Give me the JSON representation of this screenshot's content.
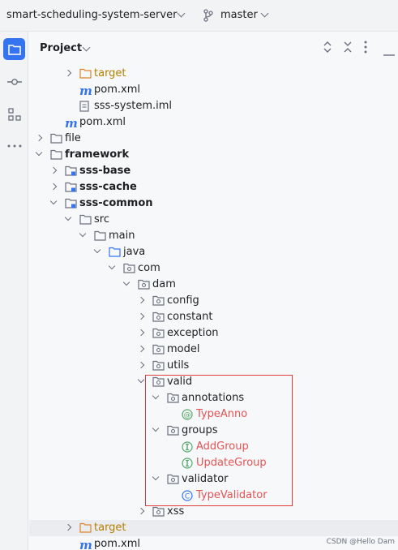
{
  "titlebar": {
    "project": "smart-scheduling-system-server",
    "branch": "master"
  },
  "rail": {
    "buttons": [
      "project-icon",
      "commit-icon",
      "structure-icon",
      "more-icon"
    ]
  },
  "panel": {
    "title": "Project"
  },
  "tree": [
    {
      "label": "target",
      "indent": 1,
      "arrow": "collapsed",
      "icon": "folder-excluded",
      "style": "excluded"
    },
    {
      "label": "pom.xml",
      "indent": 1,
      "arrow": "none",
      "icon": "maven"
    },
    {
      "label": "sss-system.iml",
      "indent": 1,
      "arrow": "none",
      "icon": "file"
    },
    {
      "label": "pom.xml",
      "indent": 0,
      "arrow": "none",
      "icon": "maven"
    },
    {
      "label": "file",
      "indent": -1,
      "arrow": "collapsed",
      "icon": "folder"
    },
    {
      "label": "framework",
      "indent": -1,
      "arrow": "expanded",
      "icon": "folder",
      "style": "bold"
    },
    {
      "label": "sss-base",
      "indent": 0,
      "arrow": "collapsed",
      "icon": "module",
      "style": "bold"
    },
    {
      "label": "sss-cache",
      "indent": 0,
      "arrow": "collapsed",
      "icon": "module",
      "style": "bold"
    },
    {
      "label": "sss-common",
      "indent": 0,
      "arrow": "expanded",
      "icon": "module",
      "style": "bold"
    },
    {
      "label": "src",
      "indent": 1,
      "arrow": "expanded",
      "icon": "folder"
    },
    {
      "label": "main",
      "indent": 2,
      "arrow": "expanded",
      "icon": "folder"
    },
    {
      "label": "java",
      "indent": 3,
      "arrow": "expanded",
      "icon": "folder-source"
    },
    {
      "label": "com",
      "indent": 4,
      "arrow": "expanded",
      "icon": "package"
    },
    {
      "label": "dam",
      "indent": 5,
      "arrow": "expanded",
      "icon": "package"
    },
    {
      "label": "config",
      "indent": 6,
      "arrow": "collapsed",
      "icon": "package"
    },
    {
      "label": "constant",
      "indent": 6,
      "arrow": "collapsed",
      "icon": "package"
    },
    {
      "label": "exception",
      "indent": 6,
      "arrow": "collapsed",
      "icon": "package"
    },
    {
      "label": "model",
      "indent": 6,
      "arrow": "collapsed",
      "icon": "package"
    },
    {
      "label": "utils",
      "indent": 6,
      "arrow": "collapsed",
      "icon": "package"
    },
    {
      "label": "valid",
      "indent": 6,
      "arrow": "expanded",
      "icon": "package"
    },
    {
      "label": "annotations",
      "indent": 7,
      "arrow": "expanded",
      "icon": "package"
    },
    {
      "label": "TypeAnno",
      "indent": 8,
      "arrow": "none",
      "icon": "annotation",
      "style": "err"
    },
    {
      "label": "groups",
      "indent": 7,
      "arrow": "expanded",
      "icon": "package"
    },
    {
      "label": "AddGroup",
      "indent": 8,
      "arrow": "none",
      "icon": "interface",
      "style": "err"
    },
    {
      "label": "UpdateGroup",
      "indent": 8,
      "arrow": "none",
      "icon": "interface",
      "style": "err"
    },
    {
      "label": "validator",
      "indent": 7,
      "arrow": "expanded",
      "icon": "package"
    },
    {
      "label": "TypeValidator",
      "indent": 8,
      "arrow": "none",
      "icon": "class",
      "style": "err"
    },
    {
      "label": "xss",
      "indent": 6,
      "arrow": "collapsed",
      "icon": "package"
    },
    {
      "label": "target",
      "indent": 1,
      "arrow": "collapsed",
      "icon": "folder-excluded",
      "style": "excluded",
      "highlight": true
    },
    {
      "label": "pom.xml",
      "indent": 1,
      "arrow": "none",
      "icon": "maven"
    }
  ],
  "watermark": "CSDN @Hello Dam"
}
